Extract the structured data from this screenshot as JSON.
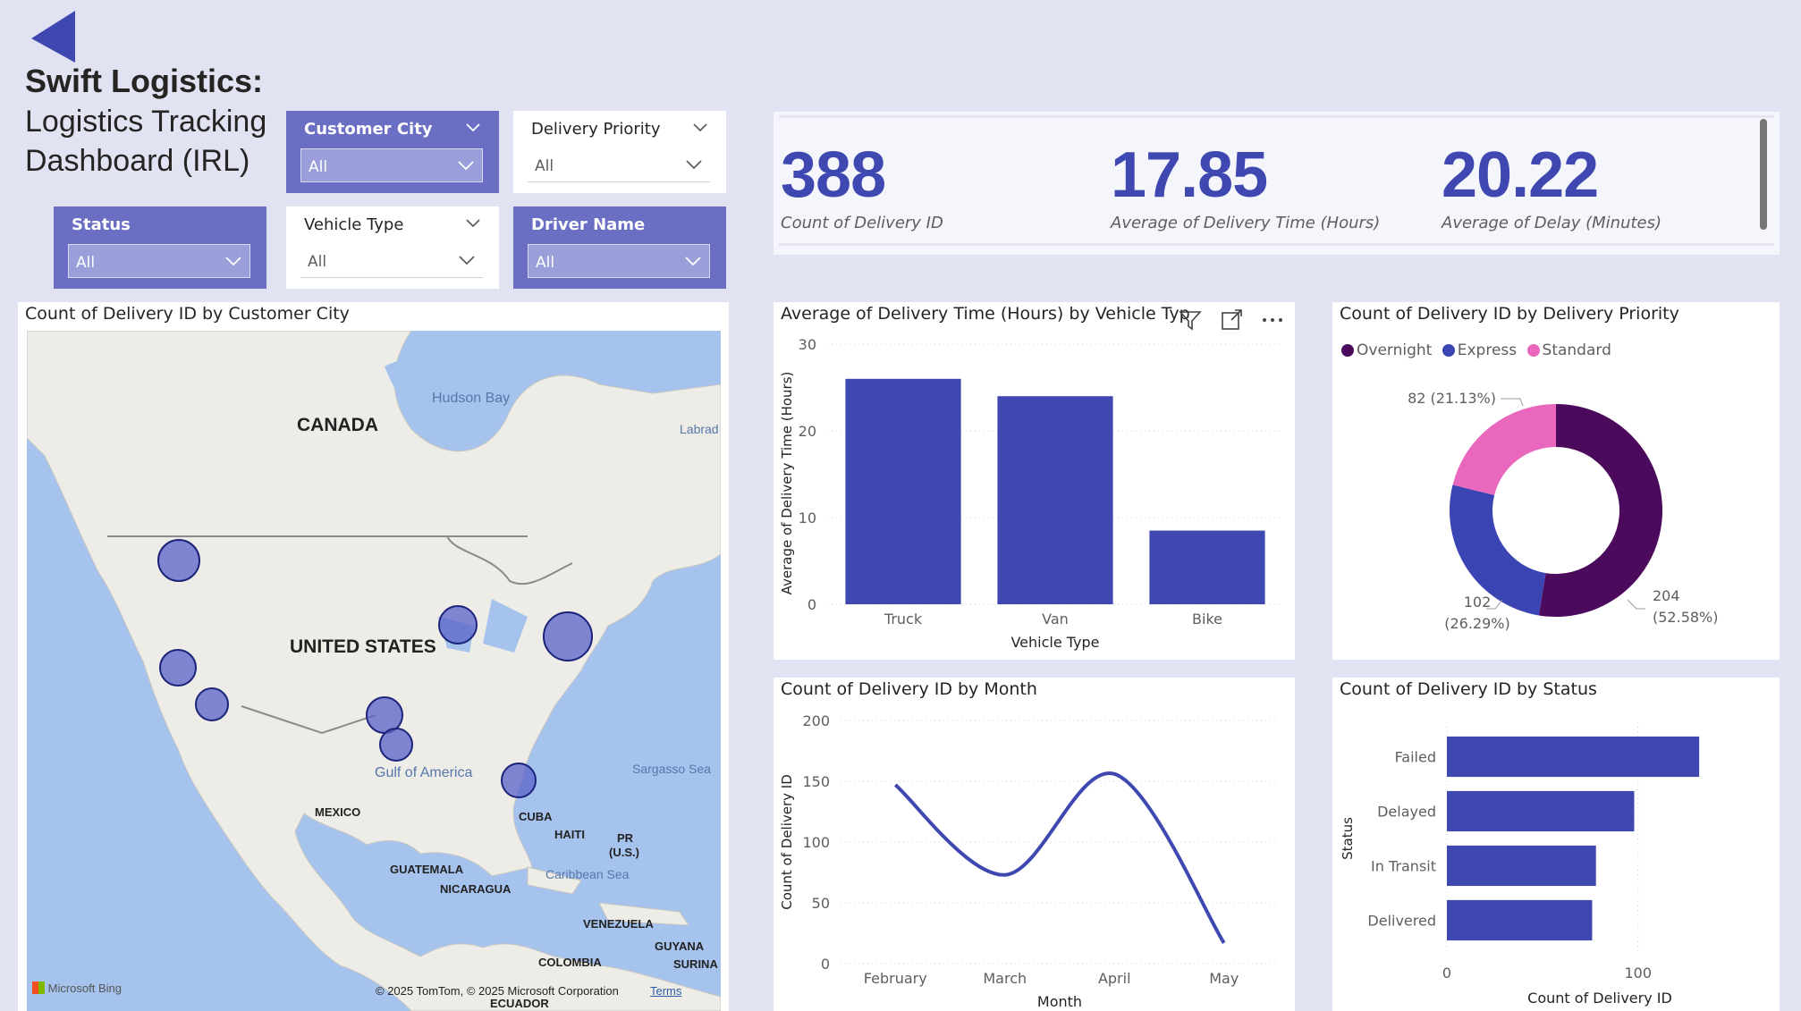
{
  "header": {
    "title_bold": "Swift Logistics:",
    "title_line1": "Logistics Tracking",
    "title_line2": "Dashboard (IRL)"
  },
  "slicers": {
    "customer_city": {
      "label": "Customer City",
      "value": "All"
    },
    "delivery_priority": {
      "label": "Delivery Priority",
      "value": "All"
    },
    "status": {
      "label": "Status",
      "value": "All"
    },
    "vehicle_type": {
      "label": "Vehicle Type",
      "value": "All"
    },
    "driver_name": {
      "label": "Driver Name",
      "value": "All"
    }
  },
  "kpis": [
    {
      "value": "388",
      "label": "Count of Delivery ID"
    },
    {
      "value": "17.85",
      "label": "Average of Delivery Time (Hours)"
    },
    {
      "value": "20.22",
      "label": "Average of Delay (Minutes)"
    }
  ],
  "map": {
    "title": "Count of Delivery ID by Customer City",
    "labels": {
      "canada": "CANADA",
      "united_states": "UNITED STATES",
      "mexico": "MEXICO",
      "cuba": "CUBA",
      "haiti": "HAITI",
      "pr": "PR",
      "us_paren": "(U.S.)",
      "guatemala": "GUATEMALA",
      "nicaragua": "NICARAGUA",
      "venezuela": "VENEZUELA",
      "colombia": "COLOMBIA",
      "guyana": "GUYANA",
      "surina": "SURINA",
      "ecuador": "ECUADOR",
      "hudson_bay": "Hudson Bay",
      "labrador": "Labrad",
      "gulf": "Gulf of America",
      "sargasso": "Sargasso Sea",
      "caribbean": "Caribbean Sea"
    },
    "attribution": "© 2025 TomTom, © 2025 Microsoft Corporation",
    "terms": "Terms",
    "bing": "Microsoft Bing"
  },
  "charts": {
    "vehicle": {
      "title": "Average of Delivery Time (Hours) by Vehicle Typ",
      "xlabel": "Vehicle Type",
      "ylabel": "Average of Delivery Time (Hours)",
      "y_ticks": [
        "0",
        "10",
        "20",
        "30"
      ]
    },
    "priority": {
      "title": "Count of Delivery ID by Delivery Priority",
      "legend": [
        "Overnight",
        "Express",
        "Standard"
      ],
      "labels": {
        "standard": "82 (21.13%)",
        "express_a": "102",
        "express_b": "(26.29%)",
        "overnight_a": "204",
        "overnight_b": "(52.58%)"
      }
    },
    "month": {
      "title": "Count of Delivery ID by Month",
      "xlabel": "Month",
      "ylabel": "Count of Delivery ID",
      "y_ticks": [
        "0",
        "50",
        "100",
        "150",
        "200"
      ]
    },
    "status": {
      "title": "Count of Delivery ID by Status",
      "xlabel": "Count of Delivery ID",
      "ylabel": "Status",
      "x_ticks": [
        "0",
        "100"
      ]
    }
  },
  "colors": {
    "accent": "#3f48b0",
    "overnight": "#4b0a5b",
    "express": "#3b44b3",
    "standard": "#e968be",
    "slicer_dark": "#6a6fc3",
    "background": "#e1e3f2"
  },
  "icons": [
    "back-arrow-icon",
    "filter-icon",
    "focus-mode-icon",
    "more-options-icon",
    "chevron-down-icon"
  ],
  "chart_data": [
    {
      "type": "bar",
      "title": "Average of Delivery Time (Hours) by Vehicle Typ",
      "categories": [
        "Truck",
        "Van",
        "Bike"
      ],
      "values": [
        26,
        24,
        8.5
      ],
      "xlabel": "Vehicle Type",
      "ylabel": "Average of Delivery Time (Hours)",
      "ylim": [
        0,
        30
      ],
      "grid": true
    },
    {
      "type": "pie",
      "subtype": "donut",
      "title": "Count of Delivery ID by Delivery Priority",
      "categories": [
        "Overnight",
        "Express",
        "Standard"
      ],
      "values": [
        204,
        102,
        82
      ],
      "percent": [
        52.58,
        26.29,
        21.13
      ],
      "legend": "top-left"
    },
    {
      "type": "line",
      "title": "Count of Delivery ID by Month",
      "x": [
        "February",
        "March",
        "April",
        "May"
      ],
      "values": [
        147,
        73,
        156,
        17
      ],
      "xlabel": "Month",
      "ylabel": "Count of Delivery ID",
      "ylim": [
        0,
        200
      ],
      "smooth": true,
      "grid": true
    },
    {
      "type": "bar",
      "orientation": "horizontal",
      "title": "Count of Delivery ID by Status",
      "categories": [
        "Failed",
        "Delayed",
        "In Transit",
        "Delivered"
      ],
      "values": [
        132,
        98,
        78,
        76
      ],
      "xlabel": "Count of Delivery ID",
      "ylabel": "Status",
      "xlim": [
        0,
        160
      ],
      "grid": true
    }
  ]
}
